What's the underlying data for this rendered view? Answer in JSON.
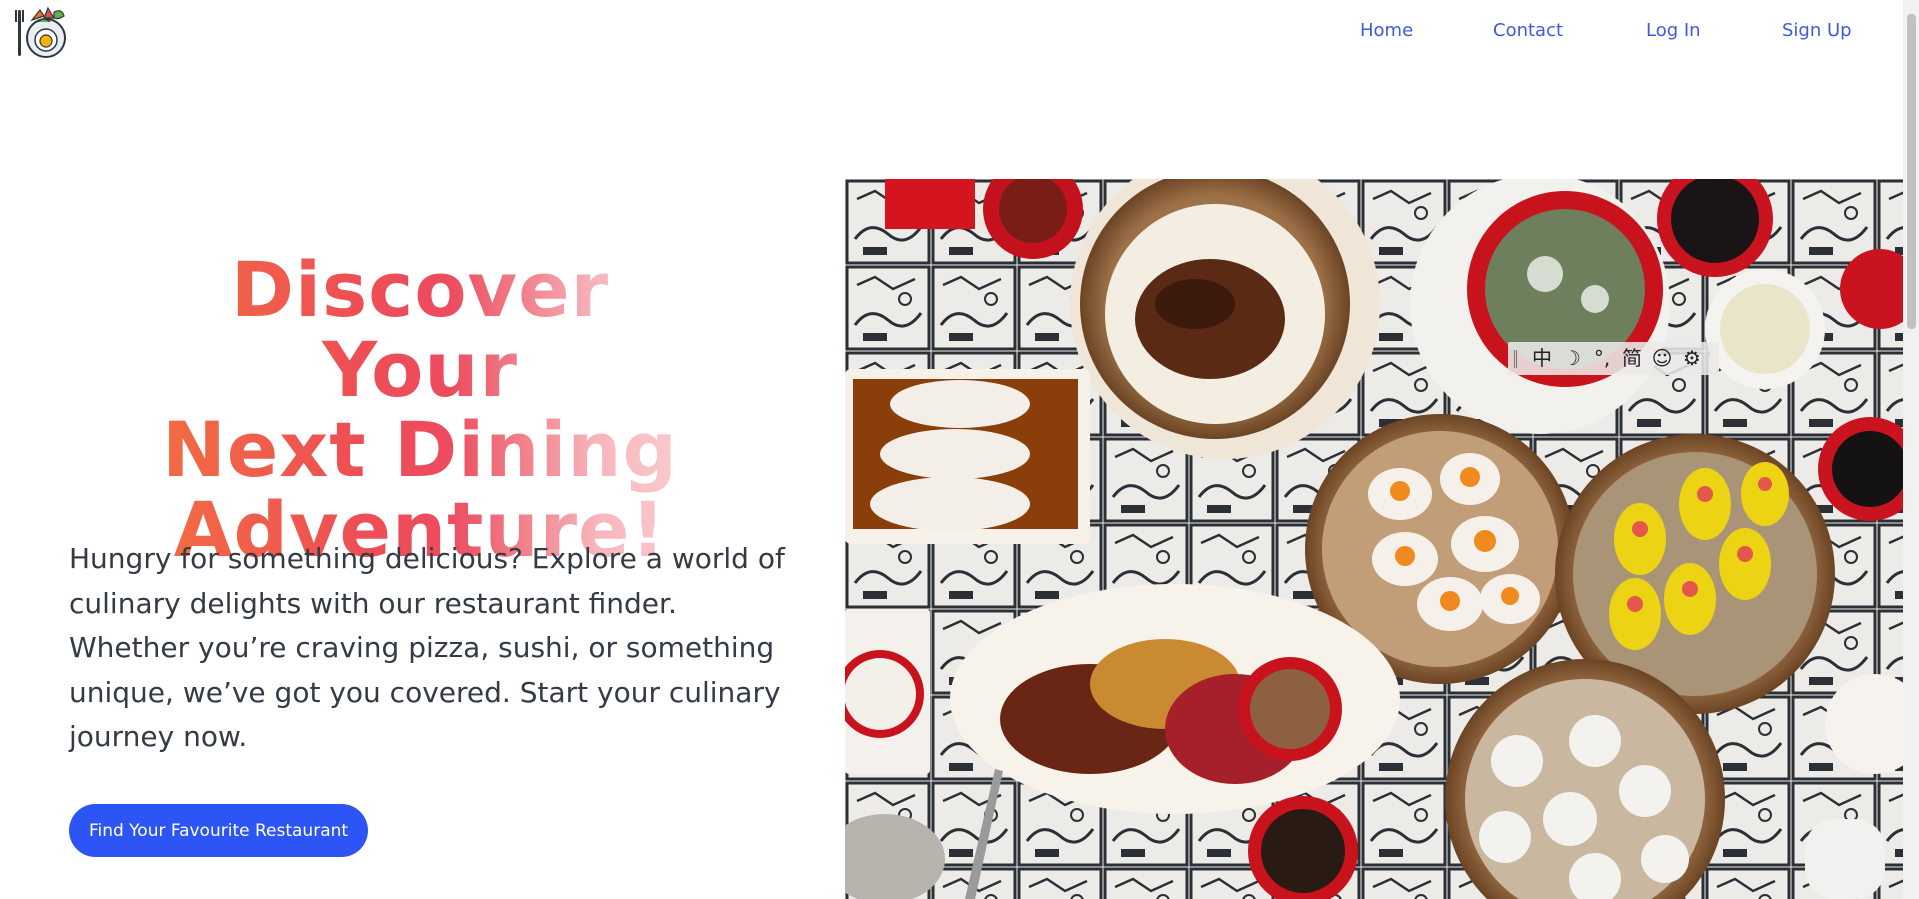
{
  "logo": {
    "icon": "food-plate-logo"
  },
  "nav": {
    "items": [
      {
        "label": "Home"
      },
      {
        "label": "Contact"
      },
      {
        "label": "Log In"
      },
      {
        "label": "Sign Up"
      }
    ]
  },
  "hero": {
    "title_lines": [
      "Discover Your",
      "Next Dining",
      "Adventure!"
    ],
    "description": "Hungry for something delicious? Explore a world of culinary delights with our restaurant finder. Whether you’re craving pizza, sushi, or something unique, we’ve got you covered. Start your culinary journey now.",
    "cta_label": "Find Your Favourite Restaurant",
    "image": "dim-sum-table-photo"
  },
  "ime_toolbar": {
    "items": [
      "中",
      "☽",
      "°,",
      "简",
      "☺",
      "⚙"
    ]
  },
  "colors": {
    "nav_link": "#3f5bd9",
    "cta_background": "#2d55f5",
    "title_gradient_start": "#f3723f",
    "title_gradient_mid": "#ee4e55",
    "title_gradient_end": "#fad3d6",
    "body_text": "#353b45"
  }
}
